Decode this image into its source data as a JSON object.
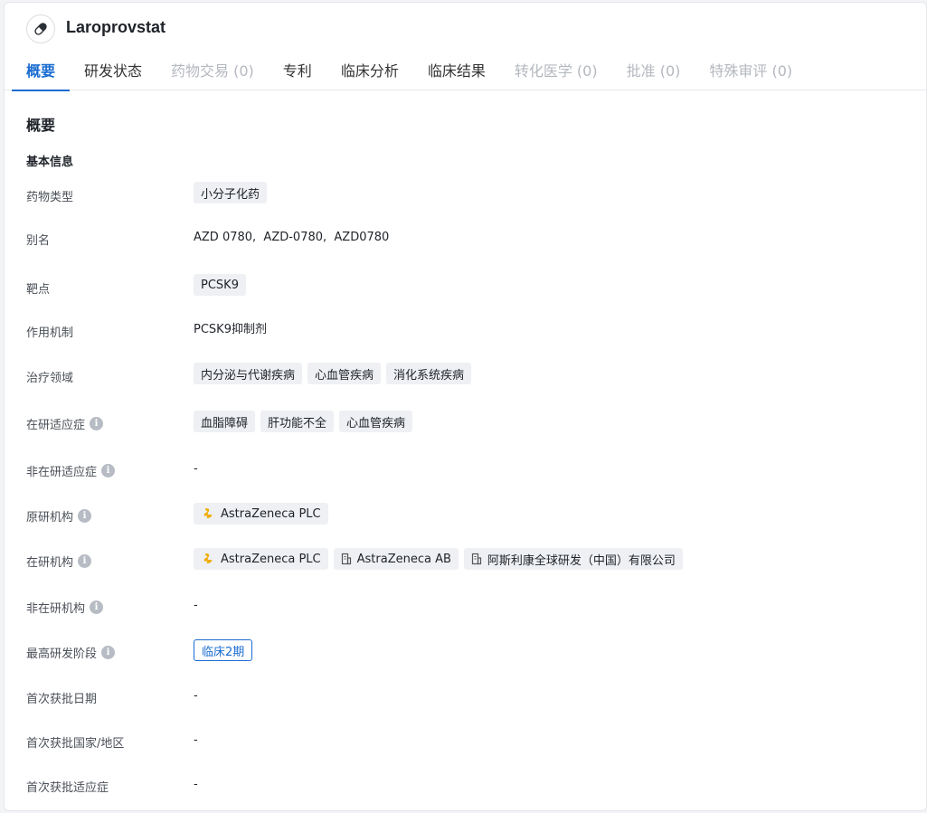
{
  "header": {
    "drug_name": "Laroprovstat",
    "drug_icon": "pill-icon"
  },
  "tabs": [
    {
      "label": "概要",
      "state": "active"
    },
    {
      "label": "研发状态",
      "state": "normal"
    },
    {
      "label": "药物交易 (0)",
      "state": "disabled"
    },
    {
      "label": "专利",
      "state": "normal"
    },
    {
      "label": "临床分析",
      "state": "normal"
    },
    {
      "label": "临床结果",
      "state": "normal"
    },
    {
      "label": "转化医学 (0)",
      "state": "disabled"
    },
    {
      "label": "批准 (0)",
      "state": "disabled"
    },
    {
      "label": "特殊审评 (0)",
      "state": "disabled"
    }
  ],
  "overview": {
    "section_title": "概要",
    "basic_info_title": "基本信息",
    "info_icon_glyph": "i",
    "fields": {
      "drug_type": {
        "label": "药物类型",
        "tags": [
          "小分子化药"
        ]
      },
      "aliases": {
        "label": "别名",
        "text": "AZD 0780,  AZD-0780,  AZD0780"
      },
      "target": {
        "label": "靶点",
        "tags": [
          "PCSK9"
        ]
      },
      "mechanism": {
        "label": "作用机制",
        "text": "PCSK9抑制剂"
      },
      "therapeutic_area": {
        "label": "治疗领域",
        "tags": [
          "内分泌与代谢疾病",
          "心血管疾病",
          "消化系统疾病"
        ]
      },
      "active_indications": {
        "label": "在研适应症",
        "tags": [
          "血脂障碍",
          "肝功能不全",
          "心血管疾病"
        ]
      },
      "inactive_indications": {
        "label": "非在研适应症",
        "text": "-"
      },
      "originator": {
        "label": "原研机构",
        "orgs": [
          {
            "name": "AstraZeneca PLC",
            "icon": "astrazeneca-logo-icon"
          }
        ]
      },
      "active_orgs": {
        "label": "在研机构",
        "orgs": [
          {
            "name": "AstraZeneca PLC",
            "icon": "astrazeneca-logo-icon"
          },
          {
            "name": "AstraZeneca AB",
            "icon": "building-icon"
          },
          {
            "name": "阿斯利康全球研发（中国）有限公司",
            "icon": "building-icon"
          }
        ]
      },
      "inactive_orgs": {
        "label": "非在研机构",
        "text": "-"
      },
      "highest_phase": {
        "label": "最高研发阶段",
        "phase": "临床2期"
      },
      "first_approval_date": {
        "label": "首次获批日期",
        "text": "-"
      },
      "first_approval_region": {
        "label": "首次获批国家/地区",
        "text": "-"
      },
      "first_approval_indication": {
        "label": "首次获批适应症",
        "text": "-"
      }
    }
  },
  "colors": {
    "accent": "#1a6cd1",
    "tag_bg": "#eef0f3",
    "disabled_text": "#b4b8bf",
    "az_logo": "#f0ab00"
  }
}
